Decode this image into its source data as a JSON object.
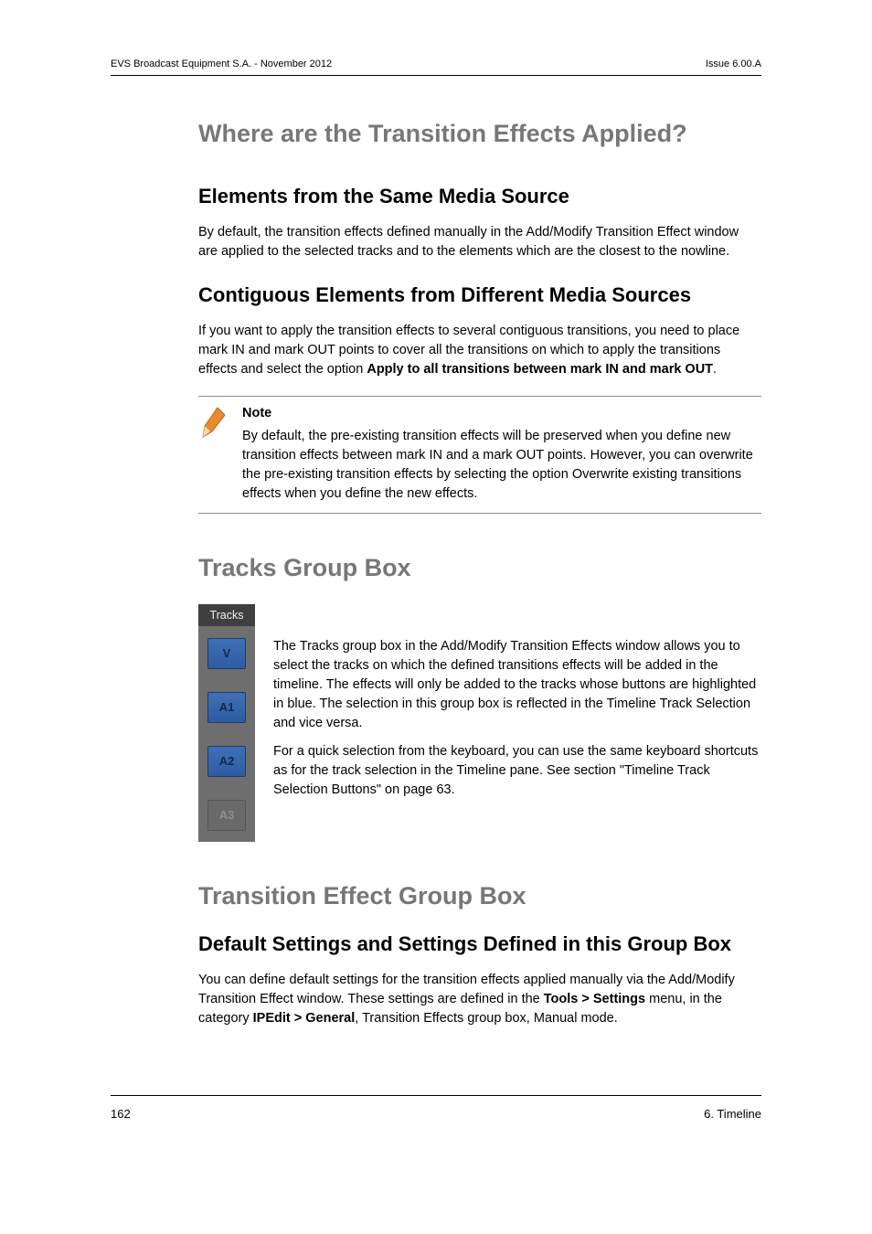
{
  "header": {
    "left": "EVS Broadcast Equipment S.A. - November 2012",
    "right": "Issue 6.00.A"
  },
  "sections": {
    "s1_title": "Where are the Transition Effects Applied?",
    "s1a_h": "Elements from the Same Media Source",
    "s1a_p": "By default, the transition effects defined manually in the Add/Modify Transition Effect window are applied to the selected tracks and to the elements which are the closest to the nowline.",
    "s1b_h": "Contiguous Elements from Different Media Sources",
    "s1b_p_pre": "If you want to apply the transition effects to several contiguous transitions, you need to place mark IN and mark OUT points to cover all the transitions on which to apply the transitions effects and select the option ",
    "s1b_p_bold": "Apply to all transitions between mark IN and mark OUT",
    "s1b_p_post": ".",
    "note_label": "Note",
    "note_body_pre": "By default, the pre-existing transition effects will be preserved when you define new transition effects between mark IN and a mark OUT points. However, you can overwrite the pre-existing transition effects by selecting the option ",
    "note_body_bold": "Overwrite existing transitions effects",
    "note_body_post": " when you define the new effects.",
    "s2_title": "Tracks Group Box",
    "tracks": {
      "header": "Tracks",
      "buttons": [
        "V",
        "A1",
        "A2",
        "A3"
      ]
    },
    "s2_p1": "The Tracks group box in the Add/Modify Transition Effects window allows you to select the tracks on which the defined transitions effects will be added in the timeline. The effects will only be added to the tracks whose buttons are highlighted in blue. The selection in this group box is reflected in the Timeline Track Selection and vice versa.",
    "s2_p2": "For a quick selection from the keyboard, you can use the same keyboard shortcuts as for the track selection in the Timeline pane. See section \"Timeline Track Selection Buttons\" on page 63.",
    "s3_title": "Transition Effect Group Box",
    "s3a_h": "Default Settings and Settings Defined in this Group Box",
    "s3a_p_1": "You can define default settings for the transition effects applied manually via the Add/Modify Transition Effect window. These settings are defined in the ",
    "s3a_p_b1": "Tools > Settings",
    "s3a_p_2": " menu, in the category ",
    "s3a_p_b2": "IPEdit > General",
    "s3a_p_3": ", Transition Effects group box, Manual mode."
  },
  "footer": {
    "left": "162",
    "right": "6. Timeline"
  }
}
